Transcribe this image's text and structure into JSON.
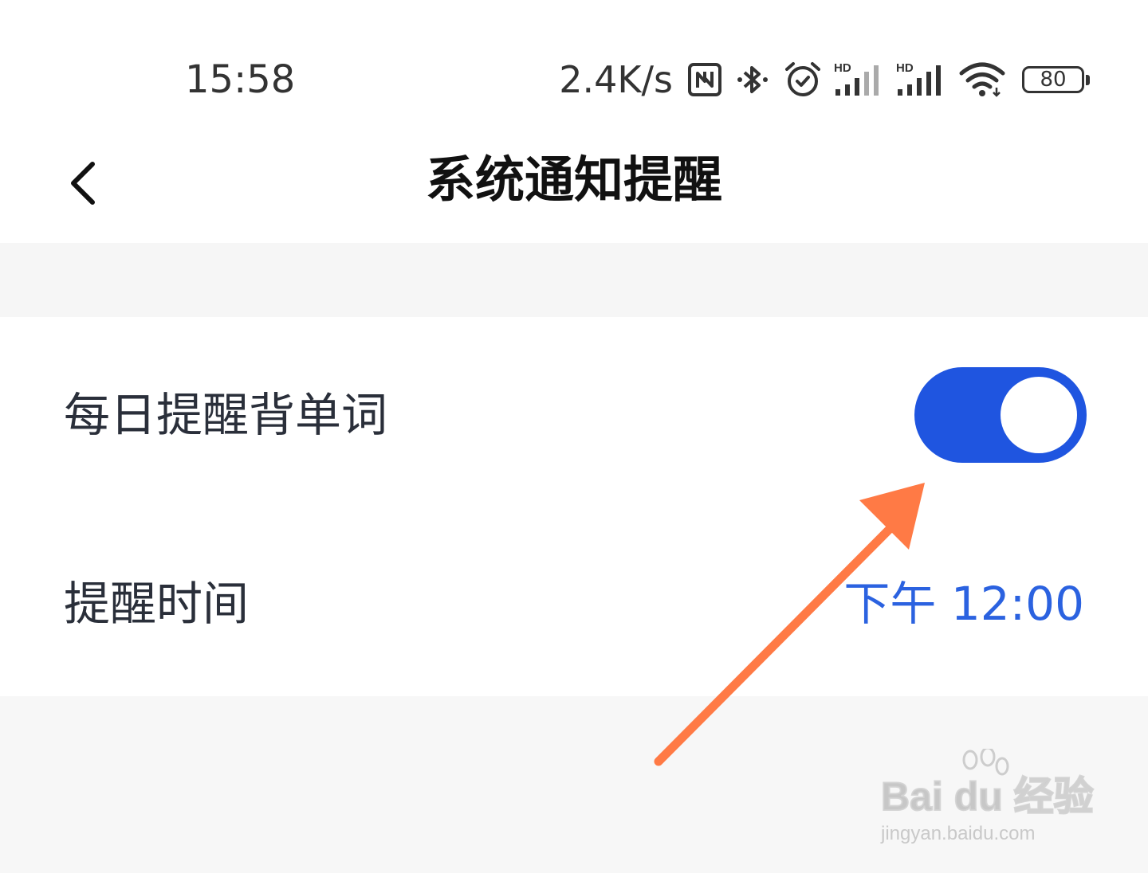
{
  "status_bar": {
    "time": "15:58",
    "net_speed": "2.4K/s",
    "battery_level": "80",
    "icons": [
      "nfc-icon",
      "bluetooth-icon",
      "alarm-icon",
      "hd-signal-1-icon",
      "hd-signal-2-icon",
      "wifi-icon",
      "battery-icon"
    ]
  },
  "header": {
    "title": "系统通知提醒"
  },
  "settings": {
    "daily_reminder_label": "每日提醒背单词",
    "daily_reminder_enabled": true,
    "reminder_time_label": "提醒时间",
    "reminder_time_value": "下午 12:00"
  },
  "watermark": {
    "logo_text": "Bai du 经验",
    "url": "jingyan.baidu.com"
  },
  "colors": {
    "toggle_on": "#1f55e0",
    "time_value": "#2b62e0",
    "annotation_arrow": "#ff7a45",
    "page_bg": "#f7f7f7"
  }
}
